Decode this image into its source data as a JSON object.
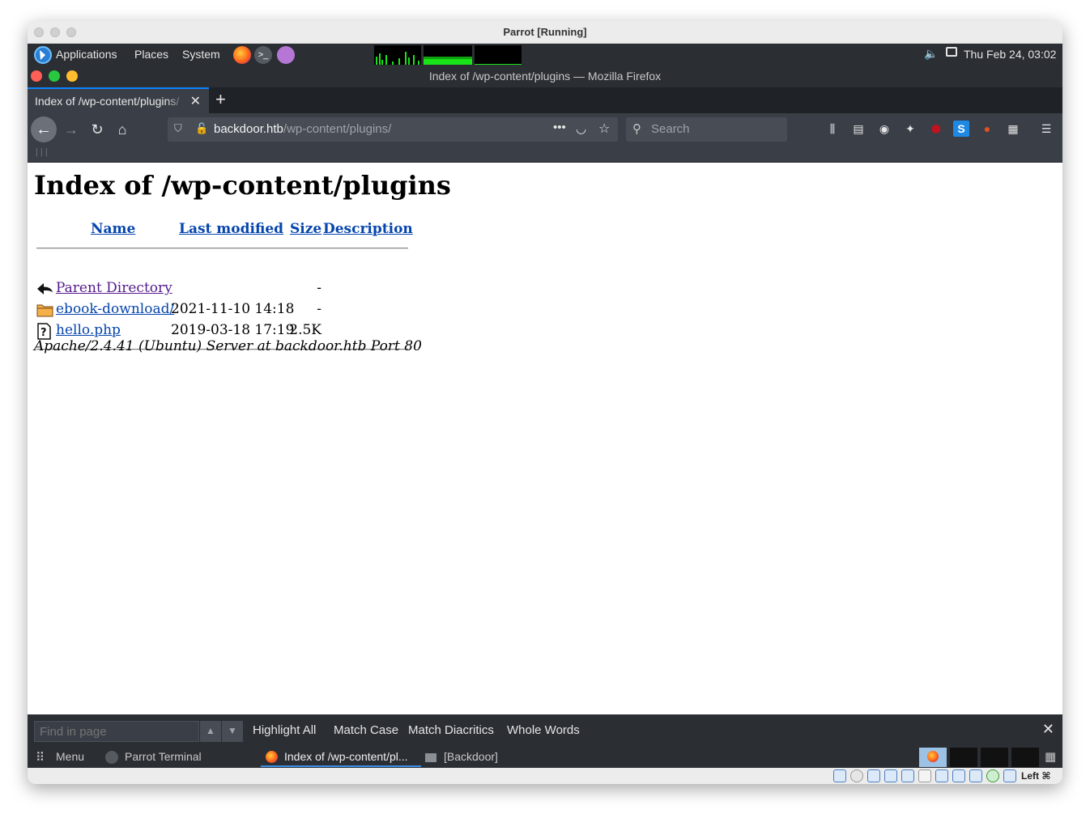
{
  "vbox": {
    "title": "Parrot [Running]",
    "host_key": "Left ⌘"
  },
  "panel": {
    "applications": "Applications",
    "places": "Places",
    "system": "System",
    "clock": "Thu Feb 24, 03:02"
  },
  "firefox": {
    "window_title": "Index of /wp-content/plugins — Mozilla Firefox",
    "tab_title": "Index of /wp-content/plugins/",
    "url_host": "backdoor.htb",
    "url_path": "/wp-content/plugins/",
    "search_placeholder": "Search"
  },
  "page": {
    "heading": "Index of /wp-content/plugins",
    "columns": {
      "name": "Name",
      "last_modified": "Last modified",
      "size": "Size",
      "description": "Description"
    },
    "rows": [
      {
        "name": "Parent Directory",
        "date": "",
        "size": "-",
        "icon": "back-arrow-icon"
      },
      {
        "name": "ebook-download/",
        "date": "2021-11-10 14:18",
        "size": "-",
        "icon": "folder-icon"
      },
      {
        "name": "hello.php",
        "date": "2019-03-18 17:19",
        "size": "2.5K",
        "icon": "unknown-file-icon"
      }
    ],
    "server_signature": "Apache/2.4.41 (Ubuntu) Server at backdoor.htb Port 80"
  },
  "findbar": {
    "placeholder": "Find in page",
    "highlight_all": "Highlight All",
    "match_case": "Match Case",
    "match_diacritics": "Match Diacritics",
    "whole_words": "Whole Words"
  },
  "taskbar": {
    "menu": "Menu",
    "tasks": [
      "Parrot Terminal",
      "Index of /wp-content/pl...",
      "[Backdoor]"
    ]
  },
  "colors": {
    "link": "#0645ad",
    "visited_link": "#551a8b",
    "accent": "#0a84ff",
    "panel_bg": "#2b2e33"
  }
}
